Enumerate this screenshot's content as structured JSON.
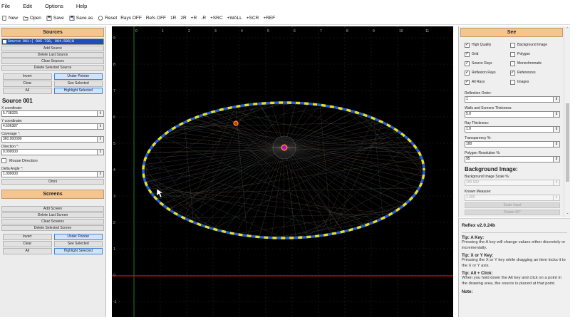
{
  "menu": [
    "File",
    "Edit",
    "Options",
    "Help"
  ],
  "toolbar": {
    "buttons": [
      {
        "label": "New",
        "icon": "new-file-icon"
      },
      {
        "label": "Open",
        "icon": "open-folder-icon"
      },
      {
        "label": "Save",
        "icon": "save-icon"
      },
      {
        "label": "Save as",
        "icon": "save-as-icon"
      },
      {
        "label": "Reset",
        "icon": "reset-icon"
      }
    ],
    "items": [
      "Rays OFF",
      "Refs OFF",
      "1R",
      "2R",
      "+R",
      "-R",
      "+SRC",
      "+WALL",
      "+SCR",
      "+REF"
    ]
  },
  "sources": {
    "header": "Sources",
    "list_item": "Source 001:( 005.738, 004.506)Ω",
    "buttons": [
      "Add Source",
      "Delete Last Source",
      "Clear Sources",
      "Delete Selected Source"
    ],
    "invert": "Invert",
    "under_pointer": "Under Pointer",
    "clear": "Clear",
    "see_selected": "See Selected",
    "all": "All",
    "highlight_selected": "Highlight Selected",
    "selected_title": "Source 001",
    "fields": [
      {
        "label": "X coordinate:",
        "value": "5.738325"
      },
      {
        "label": "Y coordinate:",
        "value": "4.506387"
      },
      {
        "label": "Coverage °:",
        "value": "360.000000"
      },
      {
        "label": "Direction °:",
        "value": "0.000000"
      }
    ],
    "mouse_direction": "Mouse Direction",
    "delta_label": "Delta Angle °:",
    "delta_value": "1.000000",
    "omni": "Omni"
  },
  "screens": {
    "header": "Screens",
    "buttons": [
      "Add Screen",
      "Delete Last Screen",
      "Clear Screens",
      "Delete Selected Screen"
    ],
    "invert": "Invert",
    "under_pointer": "Under Pointer",
    "clear": "Clear",
    "see_selected": "See Selected",
    "all": "All",
    "highlight_selected": "Highlight Selected"
  },
  "canvas": {
    "x_ticks": [
      "0",
      "1",
      "2",
      "3",
      "4",
      "5",
      "6",
      "7",
      "8",
      "9",
      "10",
      "11"
    ],
    "y_ticks": [
      "9",
      "8",
      "7",
      "6",
      "5",
      "4",
      "3",
      "2",
      "1",
      "0",
      "-1"
    ],
    "colors": {
      "wall_dash_blue": "#1f5fe0",
      "wall_dash_yellow": "#e6e020",
      "axis_red": "#d01010",
      "axis_green": "#1e7a1e"
    }
  },
  "see": {
    "header": "See",
    "options": [
      {
        "label": "High Quality",
        "checked": true
      },
      {
        "label": "Background Image",
        "checked": false
      },
      {
        "label": "Grid",
        "checked": true
      },
      {
        "label": "Polygon",
        "checked": false
      },
      {
        "label": "Source Rays",
        "checked": true
      },
      {
        "label": "Monochromatic",
        "checked": false
      },
      {
        "label": "Reflexion Rays",
        "checked": true
      },
      {
        "label": "References",
        "checked": true
      },
      {
        "label": "All Rays",
        "checked": true
      },
      {
        "label": "Images",
        "checked": false
      }
    ],
    "fields": [
      {
        "label": "Reflection Order:",
        "value": "1"
      },
      {
        "label": "Walls and Screens Thickness:",
        "value": "5.0"
      },
      {
        "label": "Ray Thickness:",
        "value": "1.0"
      },
      {
        "label": "Transparency %:",
        "value": "100"
      },
      {
        "label": "Polygon Resolution %:",
        "value": "95"
      }
    ],
    "bg_title": "Background Image:",
    "bg_scale_label": "Background Image Scale %:",
    "bg_scale_value": "100.000",
    "known_label": "Known Measure:",
    "known_value": "1.000",
    "scale_button": "Scale Input",
    "rotate_button": "Rotate 90°"
  },
  "tips": {
    "version": "Reflex v2.0.24b",
    "items": [
      {
        "title": "Tip: A Key:",
        "text": "Pressing the A key will change values either discretely or incrementally."
      },
      {
        "title": "Tip: X or Y Key:",
        "text": "Pressing the X or Y key while dragging an item locks it to the X or Y axis."
      },
      {
        "title": "Tip: Alt + Click:",
        "text": "When you hold down the Alt key and click on a point in the drawing area, the source is placed at that point."
      },
      {
        "title": "Note:",
        "text": ""
      }
    ]
  }
}
